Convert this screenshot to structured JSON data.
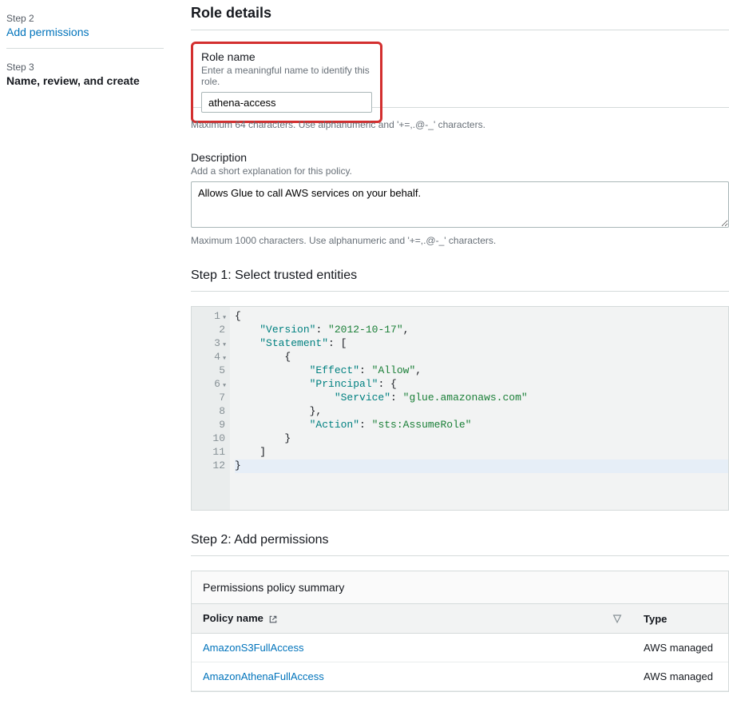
{
  "sidebar": {
    "step2_num": "Step 2",
    "step2_label": "Add permissions",
    "step3_num": "Step 3",
    "step3_label": "Name, review, and create"
  },
  "header": {
    "title": "Role details"
  },
  "role_name": {
    "label": "Role name",
    "hint": "Enter a meaningful name to identify this role.",
    "value": "athena-access",
    "constraint": "Maximum 64 characters. Use alphanumeric and '+=,.@-_' characters."
  },
  "description": {
    "label": "Description",
    "hint": "Add a short explanation for this policy.",
    "value": "Allows Glue to call AWS services on your behalf.",
    "constraint": "Maximum 1000 characters. Use alphanumeric and '+=,.@-_' characters."
  },
  "step1": {
    "title": "Step 1: Select trusted entities",
    "policy": {
      "Version": "2012-10-17",
      "Statement": [
        {
          "Effect": "Allow",
          "Principal": {
            "Service": "glue.amazonaws.com"
          },
          "Action": "sts:AssumeRole"
        }
      ]
    },
    "lines": [
      "{",
      "    \"Version\": \"2012-10-17\",",
      "    \"Statement\": [",
      "        {",
      "            \"Effect\": \"Allow\",",
      "            \"Principal\": {",
      "                \"Service\": \"glue.amazonaws.com\"",
      "            },",
      "            \"Action\": \"sts:AssumeRole\"",
      "        }",
      "    ]",
      "}"
    ]
  },
  "step2": {
    "title": "Step 2: Add permissions",
    "summary_label": "Permissions policy summary",
    "columns": {
      "policy_name": "Policy name",
      "type": "Type"
    },
    "rows": [
      {
        "name": "AmazonS3FullAccess",
        "type": "AWS managed"
      },
      {
        "name": "AmazonAthenaFullAccess",
        "type": "AWS managed"
      }
    ]
  }
}
